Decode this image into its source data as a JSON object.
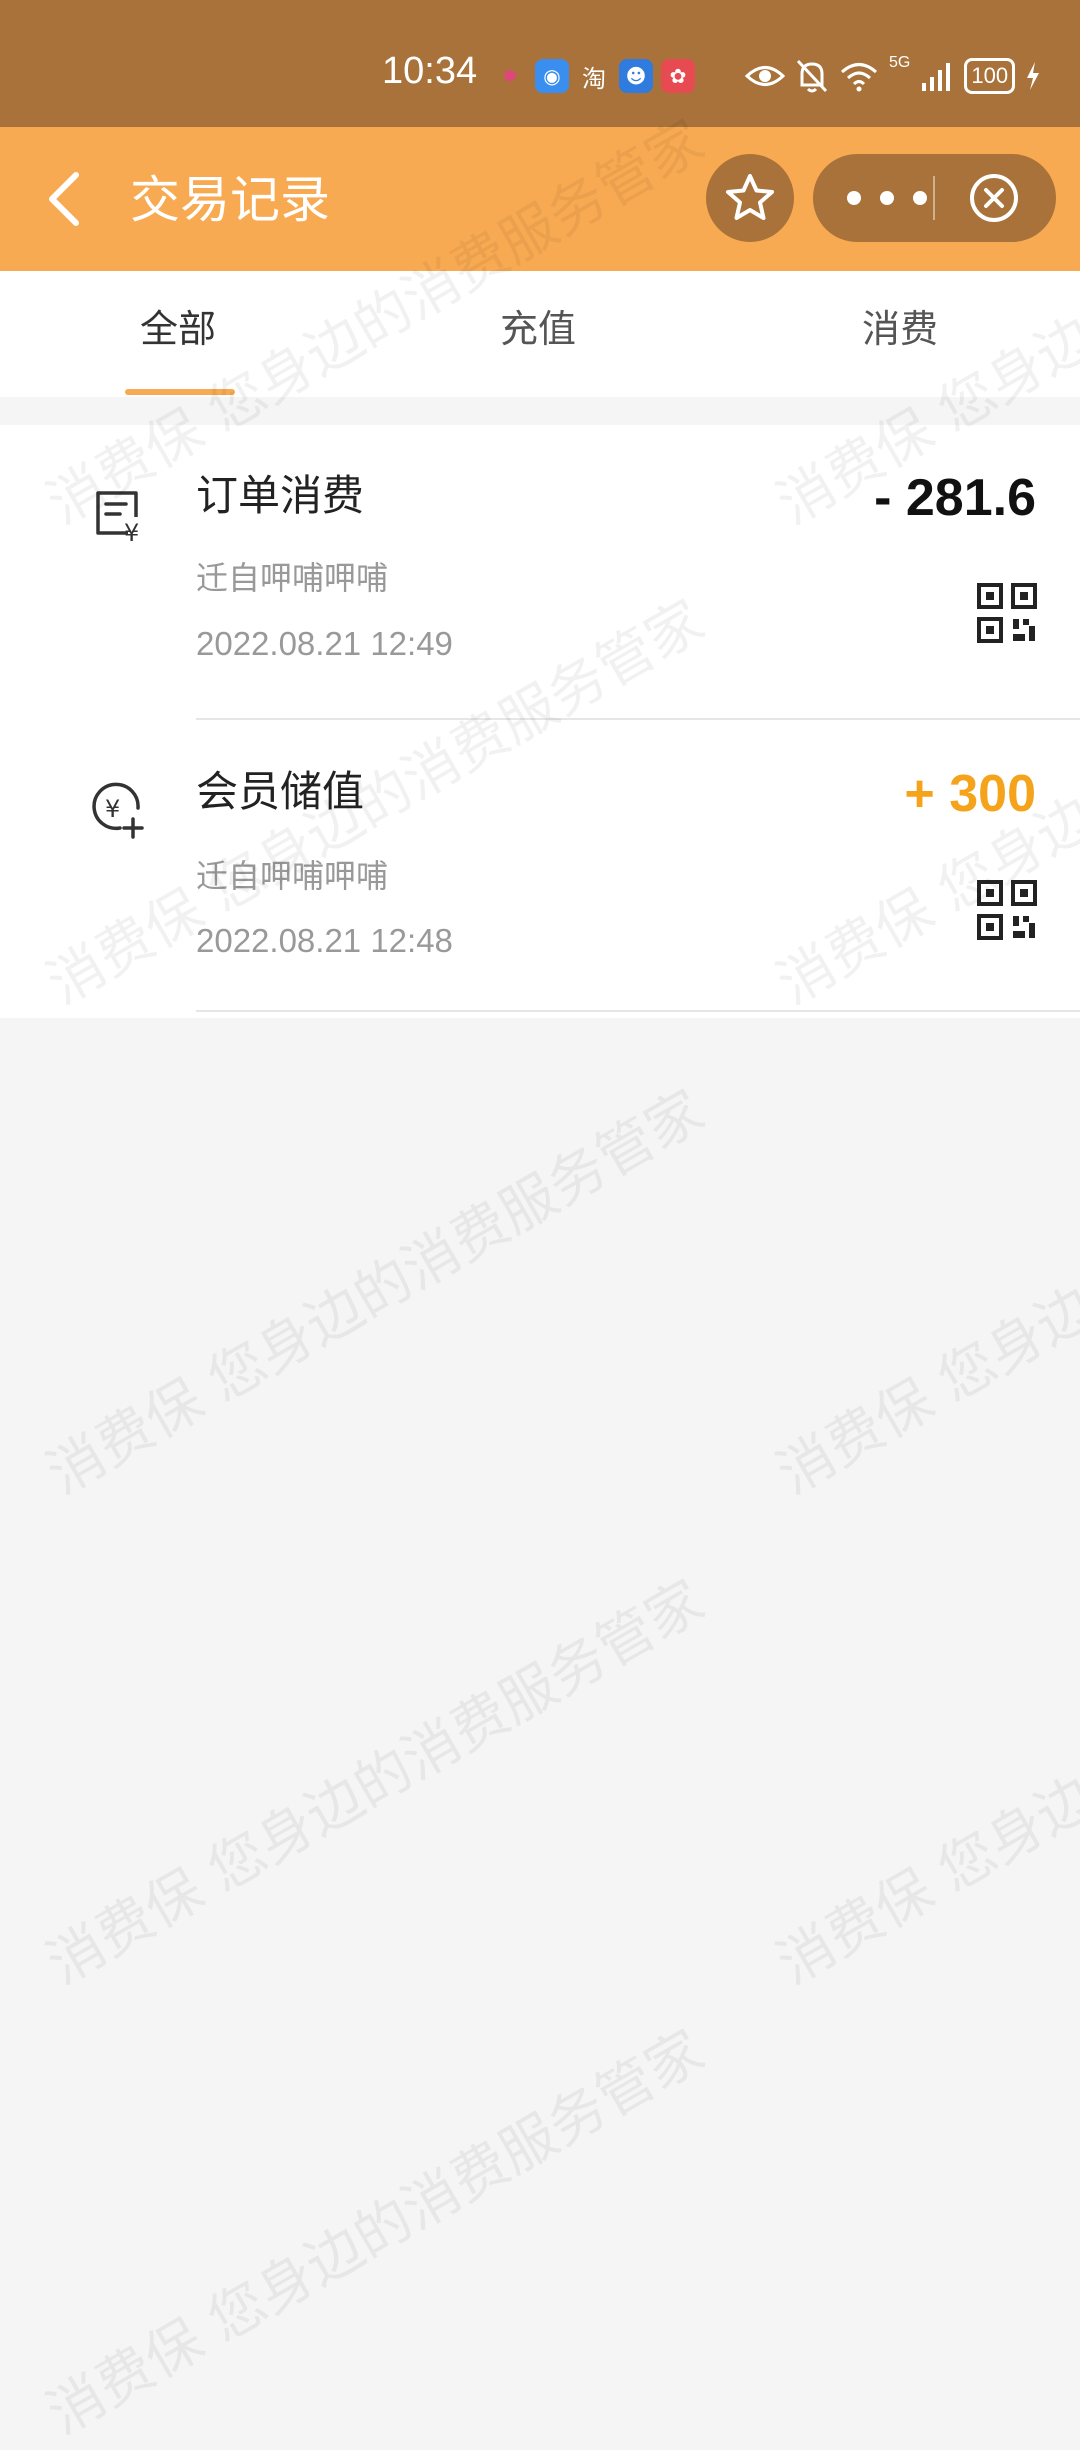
{
  "status_bar": {
    "time": "10:34",
    "app_icons": [
      {
        "name": "weibo-icon",
        "glyph": "✸",
        "bg": "transparent",
        "color": "#e0457b"
      },
      {
        "name": "browser-icon",
        "glyph": "◉",
        "bg": "#3a8ef0",
        "color": "#fff"
      },
      {
        "name": "taobao-icon",
        "glyph": "淘",
        "bg": "transparent",
        "color": "#fff"
      },
      {
        "name": "assistant-icon",
        "glyph": "☻",
        "bg": "#2f7bde",
        "color": "#fff"
      },
      {
        "name": "huawei-icon",
        "glyph": "✿",
        "bg": "#e84a52",
        "color": "#fff"
      }
    ],
    "network": "5G",
    "battery": "100"
  },
  "nav": {
    "title": "交易记录",
    "accent": "#f8aa52",
    "capsule_bg": "#a8723a"
  },
  "tabs": [
    {
      "label": "全部",
      "active": true
    },
    {
      "label": "充值",
      "active": false
    },
    {
      "label": "消费",
      "active": false
    }
  ],
  "transactions": [
    {
      "title": "订单消费",
      "merchant": "迁自呷哺呷哺",
      "time": "2022.08.21 12:49",
      "amount": "- 281.6",
      "amount_color": "#111111",
      "icon": "receipt-yuan-icon"
    },
    {
      "title": "会员储值",
      "merchant": "迁自呷哺呷哺",
      "time": "2022.08.21 12:48",
      "amount": "+ 300",
      "amount_color": "#f5a31a",
      "icon": "yuan-plus-icon"
    }
  ],
  "watermark": {
    "line_a": "消费保 您身边的消费服务管家",
    "line_b": "消费保 您身边的消费服务管家"
  }
}
